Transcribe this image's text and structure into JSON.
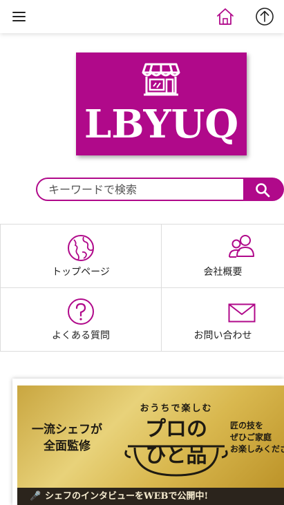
{
  "header": {
    "menu_icon": "hamburger-menu-icon",
    "home_icon": "home-icon",
    "top_icon": "arrow-up-circle-icon",
    "accent_color": "#b0098a"
  },
  "logo": {
    "text": "LBYUQ",
    "icon": "storefront-icon",
    "background": "#b0098a"
  },
  "search": {
    "placeholder": "キーワードで検索",
    "icon": "search-icon"
  },
  "nav": [
    {
      "label": "トップページ",
      "icon": "globe-icon"
    },
    {
      "label": "会社概要",
      "icon": "users-icon"
    },
    {
      "label": "よくある質問",
      "icon": "question-icon"
    },
    {
      "label": "お問い合わせ",
      "icon": "mail-icon"
    }
  ],
  "banner": {
    "left_line1": "一流シェフが",
    "left_line2": "全面監修",
    "subtitle": "おうちで楽しむ",
    "title_line1": "プロの",
    "title_line2": "ひと品",
    "right_line1": "匠の技を",
    "right_line2": "ぜひご家庭",
    "right_line3": "お楽しみくださ",
    "bottom": "シェフのインタビューをWEBで公開中!"
  }
}
